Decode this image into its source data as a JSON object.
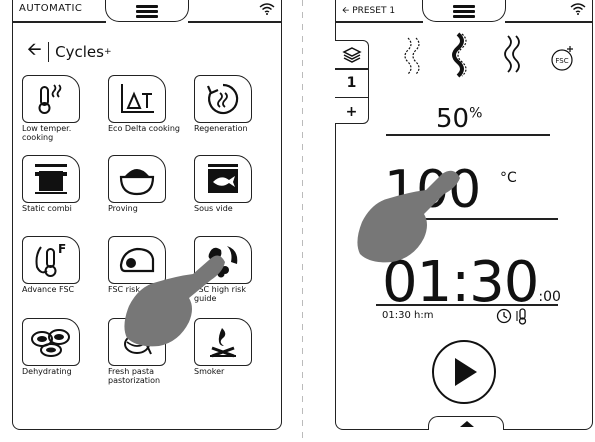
{
  "left": {
    "mode_label": "AUTOMATIC",
    "header_title": "Cycles",
    "header_mark": "+",
    "tiles": [
      {
        "label": "Low temper. cooking",
        "icon": "low-temperature-thermometer-icon"
      },
      {
        "label": "Eco Delta cooking",
        "icon": "delta-t-graph-icon"
      },
      {
        "label": "Regeneration",
        "icon": "regeneration-icon"
      },
      {
        "label": "Static combi",
        "icon": "pot-icon"
      },
      {
        "label": "Proving",
        "icon": "dough-bowl-icon"
      },
      {
        "label": "Sous vide",
        "icon": "sous-vide-fish-icon"
      },
      {
        "label": "Advance FSC",
        "icon": "fsc-thermometer-icon"
      },
      {
        "label": "FSC risk",
        "icon": "fsc-low-risk-icon"
      },
      {
        "label": "FSC high risk guide",
        "icon": "fsc-high-risk-icon"
      },
      {
        "label": "Dehydrating",
        "icon": "dried-fruit-icon"
      },
      {
        "label": "Fresh pasta pastorization",
        "icon": "fresh-pasta-icon"
      },
      {
        "label": "Smoker",
        "icon": "smoker-icon"
      }
    ]
  },
  "right": {
    "preset_label": "PRESET 1",
    "side_tools": {
      "mid": "1",
      "bottom": "+"
    },
    "fsc_label": "FSC",
    "humidity_value": "50",
    "humidity_unit": "%",
    "temperature_value": "100",
    "temperature_unit": "°C",
    "time_value": "01:30",
    "time_seconds": ":00",
    "time_format": "01:30 h:m"
  },
  "colors": {
    "ink": "#111111",
    "hand": "#777777",
    "background": "#ffffff"
  }
}
